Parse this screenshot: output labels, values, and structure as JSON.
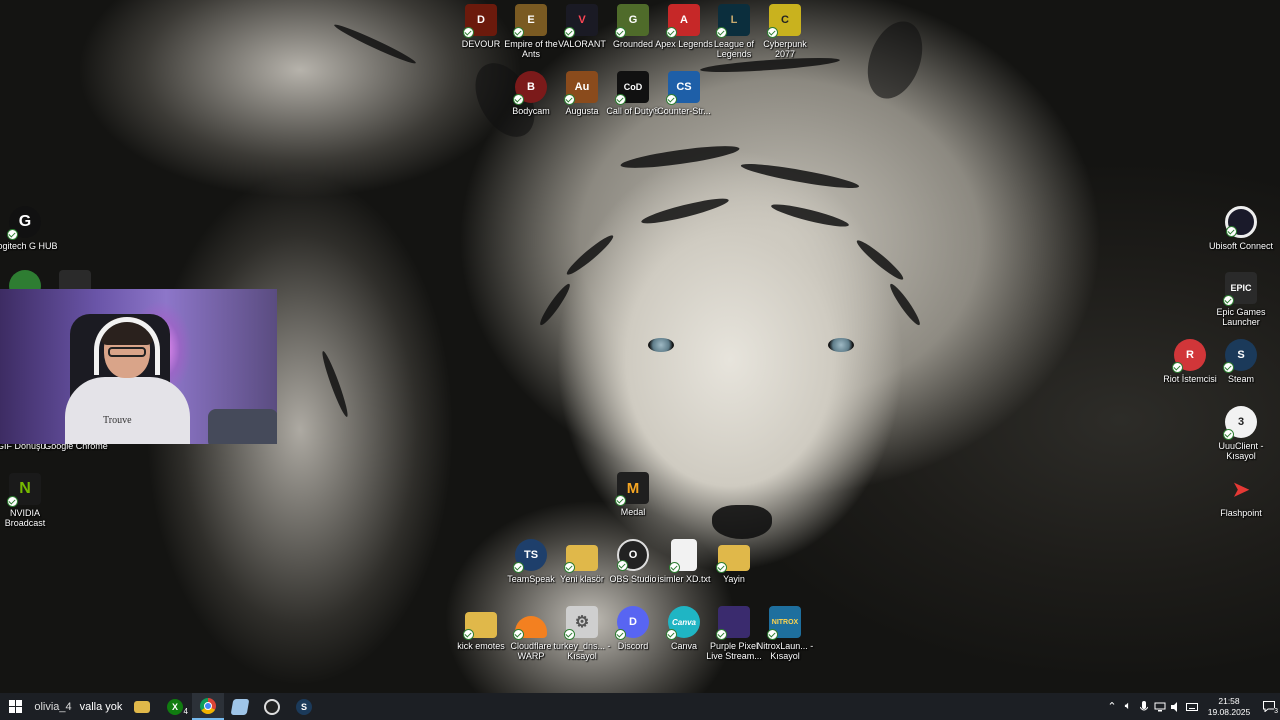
{
  "desktop": {
    "icons": [
      {
        "name": "devour-icon",
        "label": "DEVOUR",
        "color": "#6b1a0c",
        "glyph": "D"
      },
      {
        "name": "empire-of-the-ants-icon",
        "label": "Empire of the Ants",
        "color": "#7a5a22",
        "glyph": "E"
      },
      {
        "name": "valorant-icon",
        "label": "VALORANT",
        "color": "#1a1a24",
        "glyph": "V"
      },
      {
        "name": "grounded-icon",
        "label": "Grounded",
        "color": "#4f6b2a",
        "glyph": "G"
      },
      {
        "name": "apex-legends-icon",
        "label": "Apex Legends",
        "color": "#c62828",
        "glyph": "A"
      },
      {
        "name": "league-of-legends-icon",
        "label": "League of Legends",
        "color": "#0b2e3d",
        "glyph": "L"
      },
      {
        "name": "cyberpunk-2077-icon",
        "label": "Cyberpunk 2077",
        "color": "#c9b21e",
        "glyph": "C"
      },
      {
        "name": "bodycam-icon",
        "label": "Bodycam",
        "color": "#7b1a1a",
        "glyph": "B"
      },
      {
        "name": "augusta-icon",
        "label": "Augusta",
        "color": "#8a4b1c",
        "glyph": "Au"
      },
      {
        "name": "call-of-duty-icon",
        "label": "Call of Duty®",
        "color": "#111111",
        "glyph": "CoD"
      },
      {
        "name": "counter-strike-icon",
        "label": "Counter-Str...",
        "color": "#1e5fa8",
        "glyph": "CS"
      },
      {
        "name": "logitech-g-hub-icon",
        "label": "Logitech G HUB",
        "color": "#111111",
        "glyph": "G"
      },
      {
        "name": "gif-donusturucu-icon",
        "label": "GIF Dönüşü...",
        "color": "#2e7d32",
        "glyph": "G"
      },
      {
        "name": "google-chrome-icon",
        "label": "Google Chrome",
        "color": "#2e7d32",
        "glyph": "C"
      },
      {
        "name": "nvidia-broadcast-icon",
        "label": "NVIDIA Broadcast",
        "color": "#1a1a1a",
        "glyph": "N"
      },
      {
        "name": "medal-icon",
        "label": "Medal",
        "color": "#1f1f1f",
        "glyph": "M"
      },
      {
        "name": "teamspeak-icon",
        "label": "TeamSpeak",
        "color": "#1e3f6b",
        "glyph": "TS"
      },
      {
        "name": "yeni-klasor-icon",
        "label": "Yeni klasör",
        "color": "#e0b84a",
        "glyph": ""
      },
      {
        "name": "obs-studio-icon",
        "label": "OBS Studio",
        "color": "#222222",
        "glyph": "O"
      },
      {
        "name": "isimler-xd-txt-icon",
        "label": "isimler XD.txt",
        "color": "#f2f2f2",
        "glyph": ""
      },
      {
        "name": "yayin-folder-icon",
        "label": "Yayin",
        "color": "#e0b84a",
        "glyph": ""
      },
      {
        "name": "kick-emotes-icon",
        "label": "kick emotes",
        "color": "#e0b84a",
        "glyph": ""
      },
      {
        "name": "cloudflare-warp-icon",
        "label": "Cloudflare WARP",
        "color": "#f38020",
        "glyph": ""
      },
      {
        "name": "turkey-dns-icon",
        "label": "turkey_dns... - Kısayol",
        "color": "#cfcfcf",
        "glyph": "⚙"
      },
      {
        "name": "discord-icon",
        "label": "Discord",
        "color": "#5865f2",
        "glyph": "D"
      },
      {
        "name": "canva-icon",
        "label": "Canva",
        "color": "#1fb5c4",
        "glyph": "Canva"
      },
      {
        "name": "purple-pixel-icon",
        "label": "Purple Pixel Live Stream...",
        "color": "#3a2b6e",
        "glyph": ""
      },
      {
        "name": "nitrox-launcher-icon",
        "label": "NitroxLaun... - Kısayol",
        "color": "#1e6f9e",
        "glyph": "NITROX"
      },
      {
        "name": "ubisoft-connect-icon",
        "label": "Ubisoft Connect",
        "color": "#1a1a2a",
        "glyph": "U"
      },
      {
        "name": "epic-games-launcher-icon",
        "label": "Epic Games Launcher",
        "color": "#2a2a2a",
        "glyph": "EPIC"
      },
      {
        "name": "riot-istemcisi-icon",
        "label": "Riot İstemcisi",
        "color": "#d13639",
        "glyph": "R"
      },
      {
        "name": "steam-icon",
        "label": "Steam",
        "color": "#1b3a5a",
        "glyph": "S"
      },
      {
        "name": "uuuclient-icon",
        "label": "UuuClient - Kısayol",
        "color": "#f2f2f2",
        "glyph": "3"
      },
      {
        "name": "flashpoint-icon",
        "label": "Flashpoint",
        "color": "#1a1a1a",
        "glyph": "➤"
      }
    ]
  },
  "webcam": {
    "shirt_text": "Trouve"
  },
  "taskbar": {
    "start_icon": "windows-icon",
    "items": [
      {
        "name": "taskbar-olivia-item",
        "label": "olivia_4"
      },
      {
        "name": "taskbar-valla-yok-item",
        "label": "valla yok"
      }
    ],
    "xbox_badge": "4",
    "clock": {
      "time": "21:58",
      "date": "19.08.2025"
    },
    "notification_count": "3"
  }
}
